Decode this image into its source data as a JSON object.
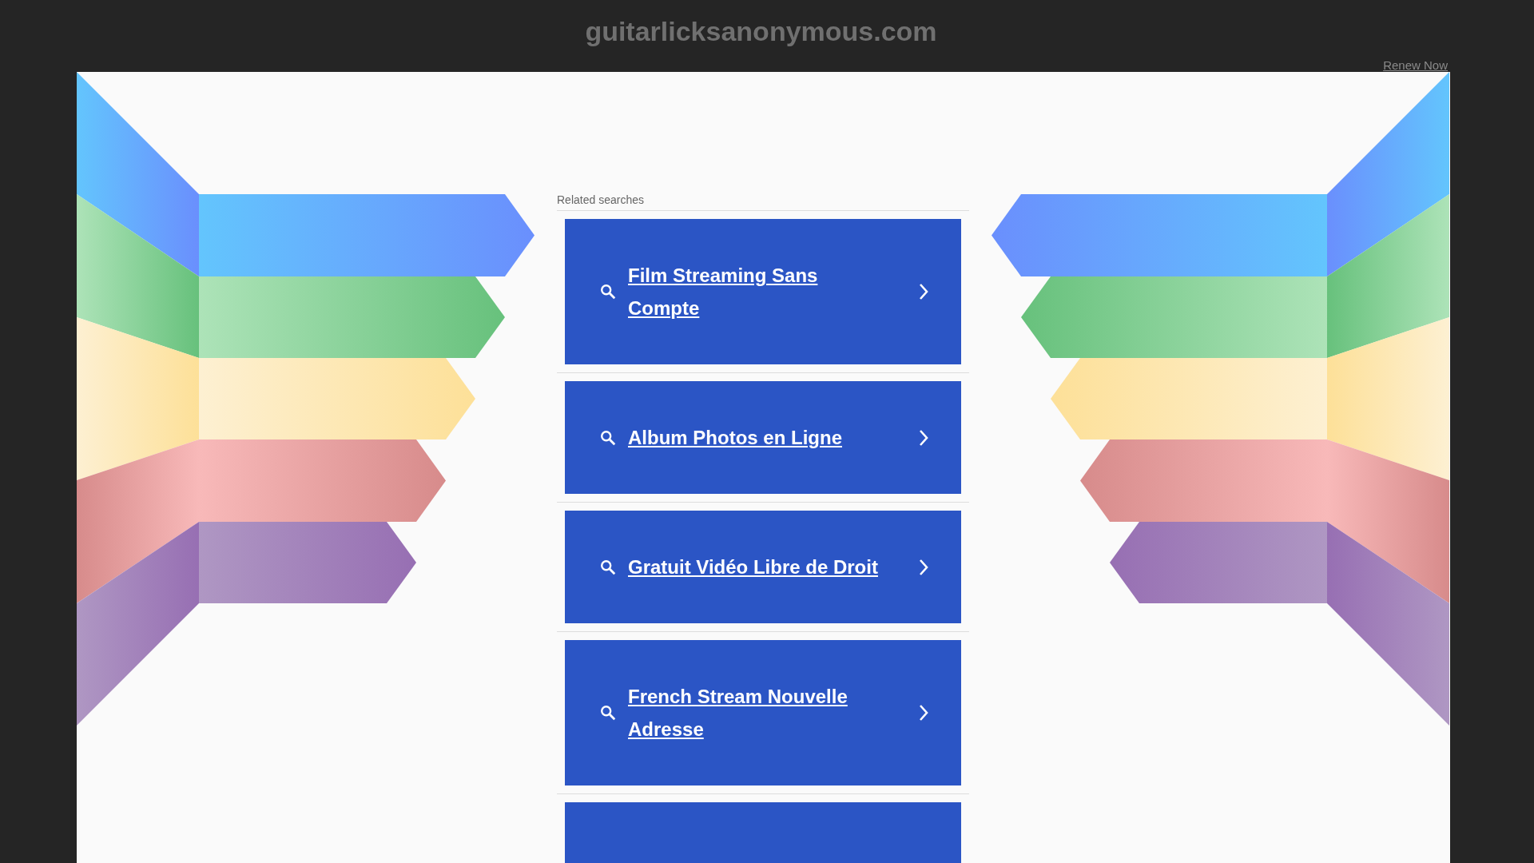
{
  "header": {
    "title": "guitarlicksanonymous.com",
    "renew_link": "Renew Now"
  },
  "related": {
    "heading": "Related searches",
    "items": [
      {
        "kind": "link",
        "label": "Film Streaming Sans Compte"
      },
      {
        "kind": "link",
        "label": "Album Photos en Ligne"
      },
      {
        "kind": "link",
        "label": "Gratuit Vidéo Libre de Droit"
      },
      {
        "kind": "link",
        "label": "French Stream Nouvelle Adresse"
      },
      {
        "kind": "cut"
      }
    ]
  }
}
